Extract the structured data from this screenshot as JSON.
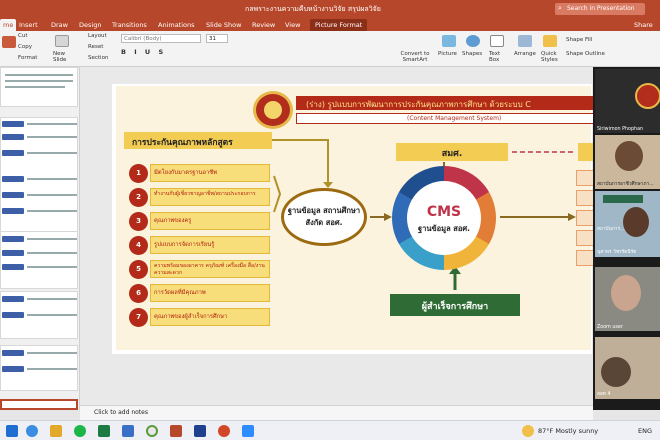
{
  "window": {
    "title": "กลพราะงานความคืบหน้างานวิจัย สรุปผลวิจัย",
    "search_placeholder": "Search in Presentation",
    "share_label": "Share"
  },
  "tabs": [
    {
      "label": "me",
      "active": true
    },
    {
      "label": "Insert"
    },
    {
      "label": "Draw"
    },
    {
      "label": "Design"
    },
    {
      "label": "Transitions"
    },
    {
      "label": "Animations"
    },
    {
      "label": "Slide Show"
    },
    {
      "label": "Review"
    },
    {
      "label": "View"
    },
    {
      "label": "Picture Format"
    }
  ],
  "ribbon": {
    "cut": "Cut",
    "copy": "Copy",
    "format": "Format",
    "new_slide": "New Slide",
    "layout": "Layout",
    "reset": "Reset",
    "section": "Section",
    "font_name": "Calibri (Body)",
    "font_size": "31",
    "convert": "Convert to SmartArt",
    "picture": "Picture",
    "shapes": "Shapes",
    "text_box": "Text Box",
    "arrange": "Arrange",
    "quick_styles": "Quick Styles",
    "shape_fill": "Shape Fill",
    "shape_outline": "Shape Outline"
  },
  "slide": {
    "title": "(ร่าง) รูปแบบการพัฒนาการประกันคุณภาพการศึกษา ด้วยระบบ C",
    "subtitle": "(Content Management System)",
    "qa_heading": "การประกันคุณภาพหลักสูตร",
    "items": [
      {
        "n": "1",
        "text": "มีตโยงกับมาตรฐานอาชีพ"
      },
      {
        "n": "2",
        "text": "ทำงานกับผู้เชี่ยวชาญอาชีพ/สถานประกอบการ"
      },
      {
        "n": "3",
        "text": "คุณภาพของครู"
      },
      {
        "n": "4",
        "text": "รูปแบบการจัดการเรียนรู้"
      },
      {
        "n": "5",
        "text": "ความพร้อมของอาคาร ครุภัณฑ์ เครื่องมือ สื่อ/งานความสะดวก"
      },
      {
        "n": "6",
        "text": "การวัดผลที่มีคุณภาพ"
      },
      {
        "n": "7",
        "text": "คุณภาพของผู้สำเร็จการศึกษา"
      }
    ],
    "db_oval": "ฐานข้อมูล สถานศึกษาสังกัด สอศ.",
    "smk": "สมศ.",
    "cms": "CMS",
    "cms_sub": "ฐานข้อมูล สอศ.",
    "graduates": "ผู้สำเร็จการศึกษา"
  },
  "notes_placeholder": "Click to add notes",
  "participants": [
    {
      "name": "Siriwimon Phophan"
    },
    {
      "name": "สถาบันการอาชีวศึกษาภา..."
    },
    {
      "name": "สถาบันการ..."
    },
    {
      "name": "นุสาพร วัชรรัตนีรัต"
    },
    {
      "name": "Zoom user"
    },
    {
      "name": "สอท 4"
    }
  ],
  "taskbar": {
    "weather": "87°F  Mostly sunny",
    "lang": "ENG"
  }
}
